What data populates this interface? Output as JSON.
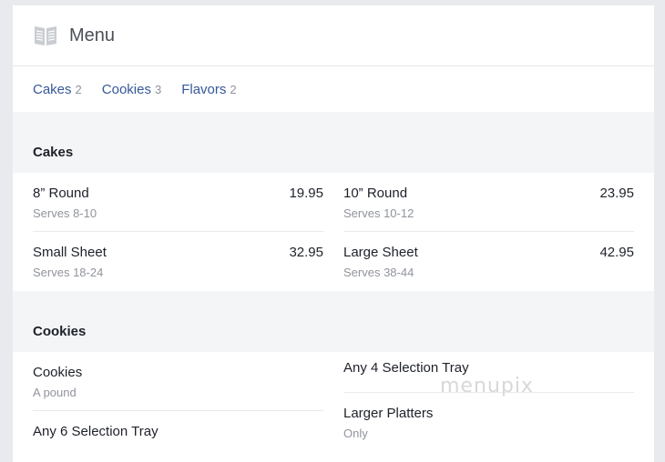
{
  "header": {
    "title": "Menu",
    "icon": "menu-book-icon"
  },
  "tabs": [
    {
      "label": "Cakes",
      "count": "2"
    },
    {
      "label": "Cookies",
      "count": "3"
    },
    {
      "label": "Flavors",
      "count": "2"
    }
  ],
  "sections": {
    "cakes": {
      "title": "Cakes",
      "items": [
        {
          "name": "8” Round",
          "price": "19.95",
          "desc": "Serves 8-10"
        },
        {
          "name": "10” Round",
          "price": "23.95",
          "desc": "Serves 10-12"
        },
        {
          "name": "Small Sheet",
          "price": "32.95",
          "desc": "Serves 18-24"
        },
        {
          "name": "Large Sheet",
          "price": "42.95",
          "desc": "Serves 38-44"
        }
      ]
    },
    "cookies": {
      "title": "Cookies",
      "items": [
        {
          "name": "Cookies",
          "desc": "A pound"
        },
        {
          "name": "Any 6 Selection Tray"
        },
        {
          "name": "Any 4 Selection Tray"
        },
        {
          "name": "Larger Platters",
          "desc": "Only"
        }
      ]
    }
  },
  "watermark": "menupix"
}
